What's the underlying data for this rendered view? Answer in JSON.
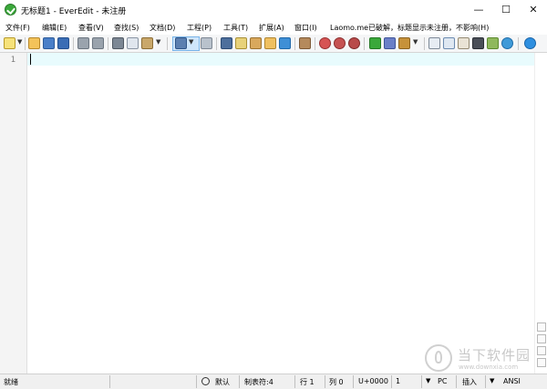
{
  "window": {
    "title": "无标题1 - EverEdit - 未注册",
    "controls": {
      "minimize": "—",
      "maximize": "☐",
      "close": "✕"
    }
  },
  "menu": [
    "文件(F)",
    "编辑(E)",
    "查看(V)",
    "查找(S)",
    "文档(D)",
    "工程(P)",
    "工具(T)",
    "扩展(A)",
    "窗口(I)",
    "Laomo.me已破解，标题显示未注册，不影响(H)"
  ],
  "toolbar": {
    "icons": [
      "new-file-icon",
      "open-folder-icon",
      "save-icon",
      "save-all-icon",
      "undo-icon",
      "redo-icon",
      "cut-icon",
      "copy-icon",
      "paste-icon",
      "wrap-icon",
      "format-icon",
      "find-icon",
      "find-in-files-icon",
      "replace-icon",
      "find-replace-icon",
      "bookmark-icon",
      "columns-icon",
      "macro-record-icon",
      "macro-play-icon",
      "macro-stop-icon",
      "snippet-icon",
      "run-icon",
      "build-tool-icon",
      "panel-left-icon",
      "panel-right-icon",
      "document-props-icon",
      "console-icon",
      "charmap-icon",
      "browser-icon",
      "help-icon"
    ]
  },
  "editor": {
    "line_numbers": [
      "1"
    ],
    "current_line_color": "#e8fbfd"
  },
  "status": {
    "ready": "就绪",
    "encoding_mode": "默认",
    "tab_size": "制表符:4",
    "line": "行 1",
    "column": "列 0",
    "unicode": "U+0000",
    "count": "1",
    "line_ending": "PC",
    "insert_mode": "插入",
    "charset": "ANSI"
  },
  "watermark": {
    "title": "当下软件园",
    "url": "www.downxia.com"
  },
  "colors": {
    "accent_green": "#3aa83a",
    "active_toolbar": "#cfe6fb"
  }
}
